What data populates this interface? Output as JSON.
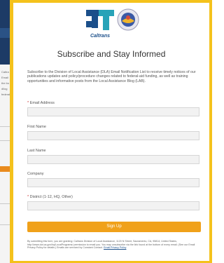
{
  "background_page": {
    "text_lines": [
      "Caltra",
      "Email",
      "the bo",
      "dilog",
      "federal-"
    ]
  },
  "modal": {
    "logo_wordmark": "Caltrans",
    "title": "Subscribe and Stay Informed",
    "description": "Subscribe to the Division of Local Assistance (DLA) Email Notification List to receive timely notices of our publications updates and policy/procedure changes related to federal-aid funding, as well as training opportunities and informative posts from the Local Assistance Blog (LAB).",
    "fields": [
      {
        "label": "Email Address",
        "required": true,
        "value": ""
      },
      {
        "label": "First Name",
        "required": false,
        "value": ""
      },
      {
        "label": "Last Name",
        "required": false,
        "value": ""
      },
      {
        "label": "Company",
        "required": false,
        "value": ""
      },
      {
        "label": "District (1-12, HQ, Other)",
        "required": true,
        "value": ""
      }
    ],
    "submit_label": "Sign Up",
    "footer_text": "By submitting this form, you are granting: Caltrans Division of Local Assistance, 1120 N Street, Sacramento, CA, 95814, United States, http://www.dot.ca.gov/hq/LocalPrograms/ permission to email you. You may unsubscribe via the link found at the bottom of every email. (See our Email Privacy Policy for details.) Emails are serviced by Constant Contact.",
    "footer_link": "Email Privacy Policy",
    "colors": {
      "frame": "#f4c21c",
      "button": "#f0a11a",
      "brand_blue": "#1b4f8a",
      "brand_teal": "#28a3b8"
    }
  }
}
